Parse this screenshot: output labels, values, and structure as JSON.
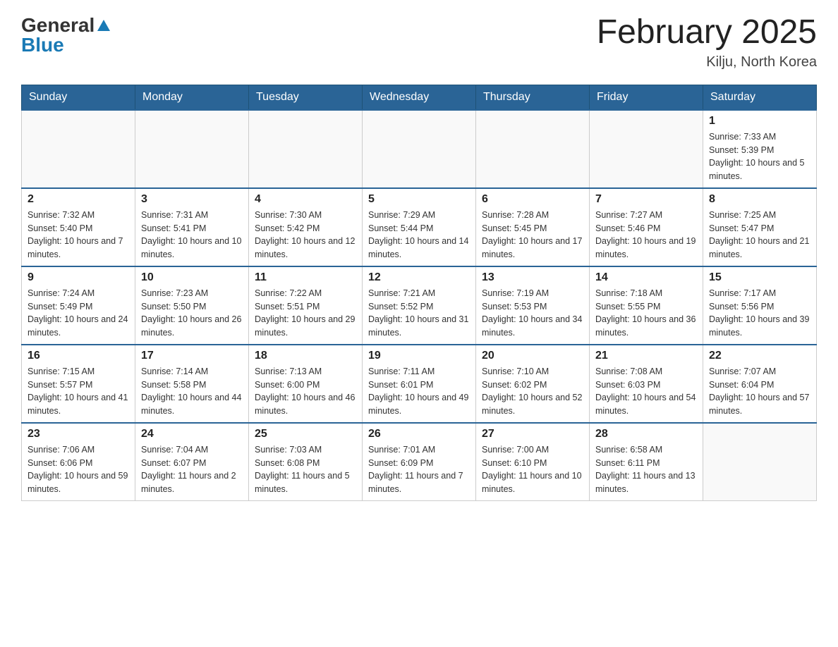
{
  "header": {
    "logo": {
      "general": "General",
      "blue": "Blue",
      "triangle": "▲"
    },
    "title": "February 2025",
    "location": "Kilju, North Korea"
  },
  "weekdays": [
    "Sunday",
    "Monday",
    "Tuesday",
    "Wednesday",
    "Thursday",
    "Friday",
    "Saturday"
  ],
  "weeks": [
    [
      {
        "day": "",
        "info": ""
      },
      {
        "day": "",
        "info": ""
      },
      {
        "day": "",
        "info": ""
      },
      {
        "day": "",
        "info": ""
      },
      {
        "day": "",
        "info": ""
      },
      {
        "day": "",
        "info": ""
      },
      {
        "day": "1",
        "info": "Sunrise: 7:33 AM\nSunset: 5:39 PM\nDaylight: 10 hours and 5 minutes."
      }
    ],
    [
      {
        "day": "2",
        "info": "Sunrise: 7:32 AM\nSunset: 5:40 PM\nDaylight: 10 hours and 7 minutes."
      },
      {
        "day": "3",
        "info": "Sunrise: 7:31 AM\nSunset: 5:41 PM\nDaylight: 10 hours and 10 minutes."
      },
      {
        "day": "4",
        "info": "Sunrise: 7:30 AM\nSunset: 5:42 PM\nDaylight: 10 hours and 12 minutes."
      },
      {
        "day": "5",
        "info": "Sunrise: 7:29 AM\nSunset: 5:44 PM\nDaylight: 10 hours and 14 minutes."
      },
      {
        "day": "6",
        "info": "Sunrise: 7:28 AM\nSunset: 5:45 PM\nDaylight: 10 hours and 17 minutes."
      },
      {
        "day": "7",
        "info": "Sunrise: 7:27 AM\nSunset: 5:46 PM\nDaylight: 10 hours and 19 minutes."
      },
      {
        "day": "8",
        "info": "Sunrise: 7:25 AM\nSunset: 5:47 PM\nDaylight: 10 hours and 21 minutes."
      }
    ],
    [
      {
        "day": "9",
        "info": "Sunrise: 7:24 AM\nSunset: 5:49 PM\nDaylight: 10 hours and 24 minutes."
      },
      {
        "day": "10",
        "info": "Sunrise: 7:23 AM\nSunset: 5:50 PM\nDaylight: 10 hours and 26 minutes."
      },
      {
        "day": "11",
        "info": "Sunrise: 7:22 AM\nSunset: 5:51 PM\nDaylight: 10 hours and 29 minutes."
      },
      {
        "day": "12",
        "info": "Sunrise: 7:21 AM\nSunset: 5:52 PM\nDaylight: 10 hours and 31 minutes."
      },
      {
        "day": "13",
        "info": "Sunrise: 7:19 AM\nSunset: 5:53 PM\nDaylight: 10 hours and 34 minutes."
      },
      {
        "day": "14",
        "info": "Sunrise: 7:18 AM\nSunset: 5:55 PM\nDaylight: 10 hours and 36 minutes."
      },
      {
        "day": "15",
        "info": "Sunrise: 7:17 AM\nSunset: 5:56 PM\nDaylight: 10 hours and 39 minutes."
      }
    ],
    [
      {
        "day": "16",
        "info": "Sunrise: 7:15 AM\nSunset: 5:57 PM\nDaylight: 10 hours and 41 minutes."
      },
      {
        "day": "17",
        "info": "Sunrise: 7:14 AM\nSunset: 5:58 PM\nDaylight: 10 hours and 44 minutes."
      },
      {
        "day": "18",
        "info": "Sunrise: 7:13 AM\nSunset: 6:00 PM\nDaylight: 10 hours and 46 minutes."
      },
      {
        "day": "19",
        "info": "Sunrise: 7:11 AM\nSunset: 6:01 PM\nDaylight: 10 hours and 49 minutes."
      },
      {
        "day": "20",
        "info": "Sunrise: 7:10 AM\nSunset: 6:02 PM\nDaylight: 10 hours and 52 minutes."
      },
      {
        "day": "21",
        "info": "Sunrise: 7:08 AM\nSunset: 6:03 PM\nDaylight: 10 hours and 54 minutes."
      },
      {
        "day": "22",
        "info": "Sunrise: 7:07 AM\nSunset: 6:04 PM\nDaylight: 10 hours and 57 minutes."
      }
    ],
    [
      {
        "day": "23",
        "info": "Sunrise: 7:06 AM\nSunset: 6:06 PM\nDaylight: 10 hours and 59 minutes."
      },
      {
        "day": "24",
        "info": "Sunrise: 7:04 AM\nSunset: 6:07 PM\nDaylight: 11 hours and 2 minutes."
      },
      {
        "day": "25",
        "info": "Sunrise: 7:03 AM\nSunset: 6:08 PM\nDaylight: 11 hours and 5 minutes."
      },
      {
        "day": "26",
        "info": "Sunrise: 7:01 AM\nSunset: 6:09 PM\nDaylight: 11 hours and 7 minutes."
      },
      {
        "day": "27",
        "info": "Sunrise: 7:00 AM\nSunset: 6:10 PM\nDaylight: 11 hours and 10 minutes."
      },
      {
        "day": "28",
        "info": "Sunrise: 6:58 AM\nSunset: 6:11 PM\nDaylight: 11 hours and 13 minutes."
      },
      {
        "day": "",
        "info": ""
      }
    ]
  ]
}
